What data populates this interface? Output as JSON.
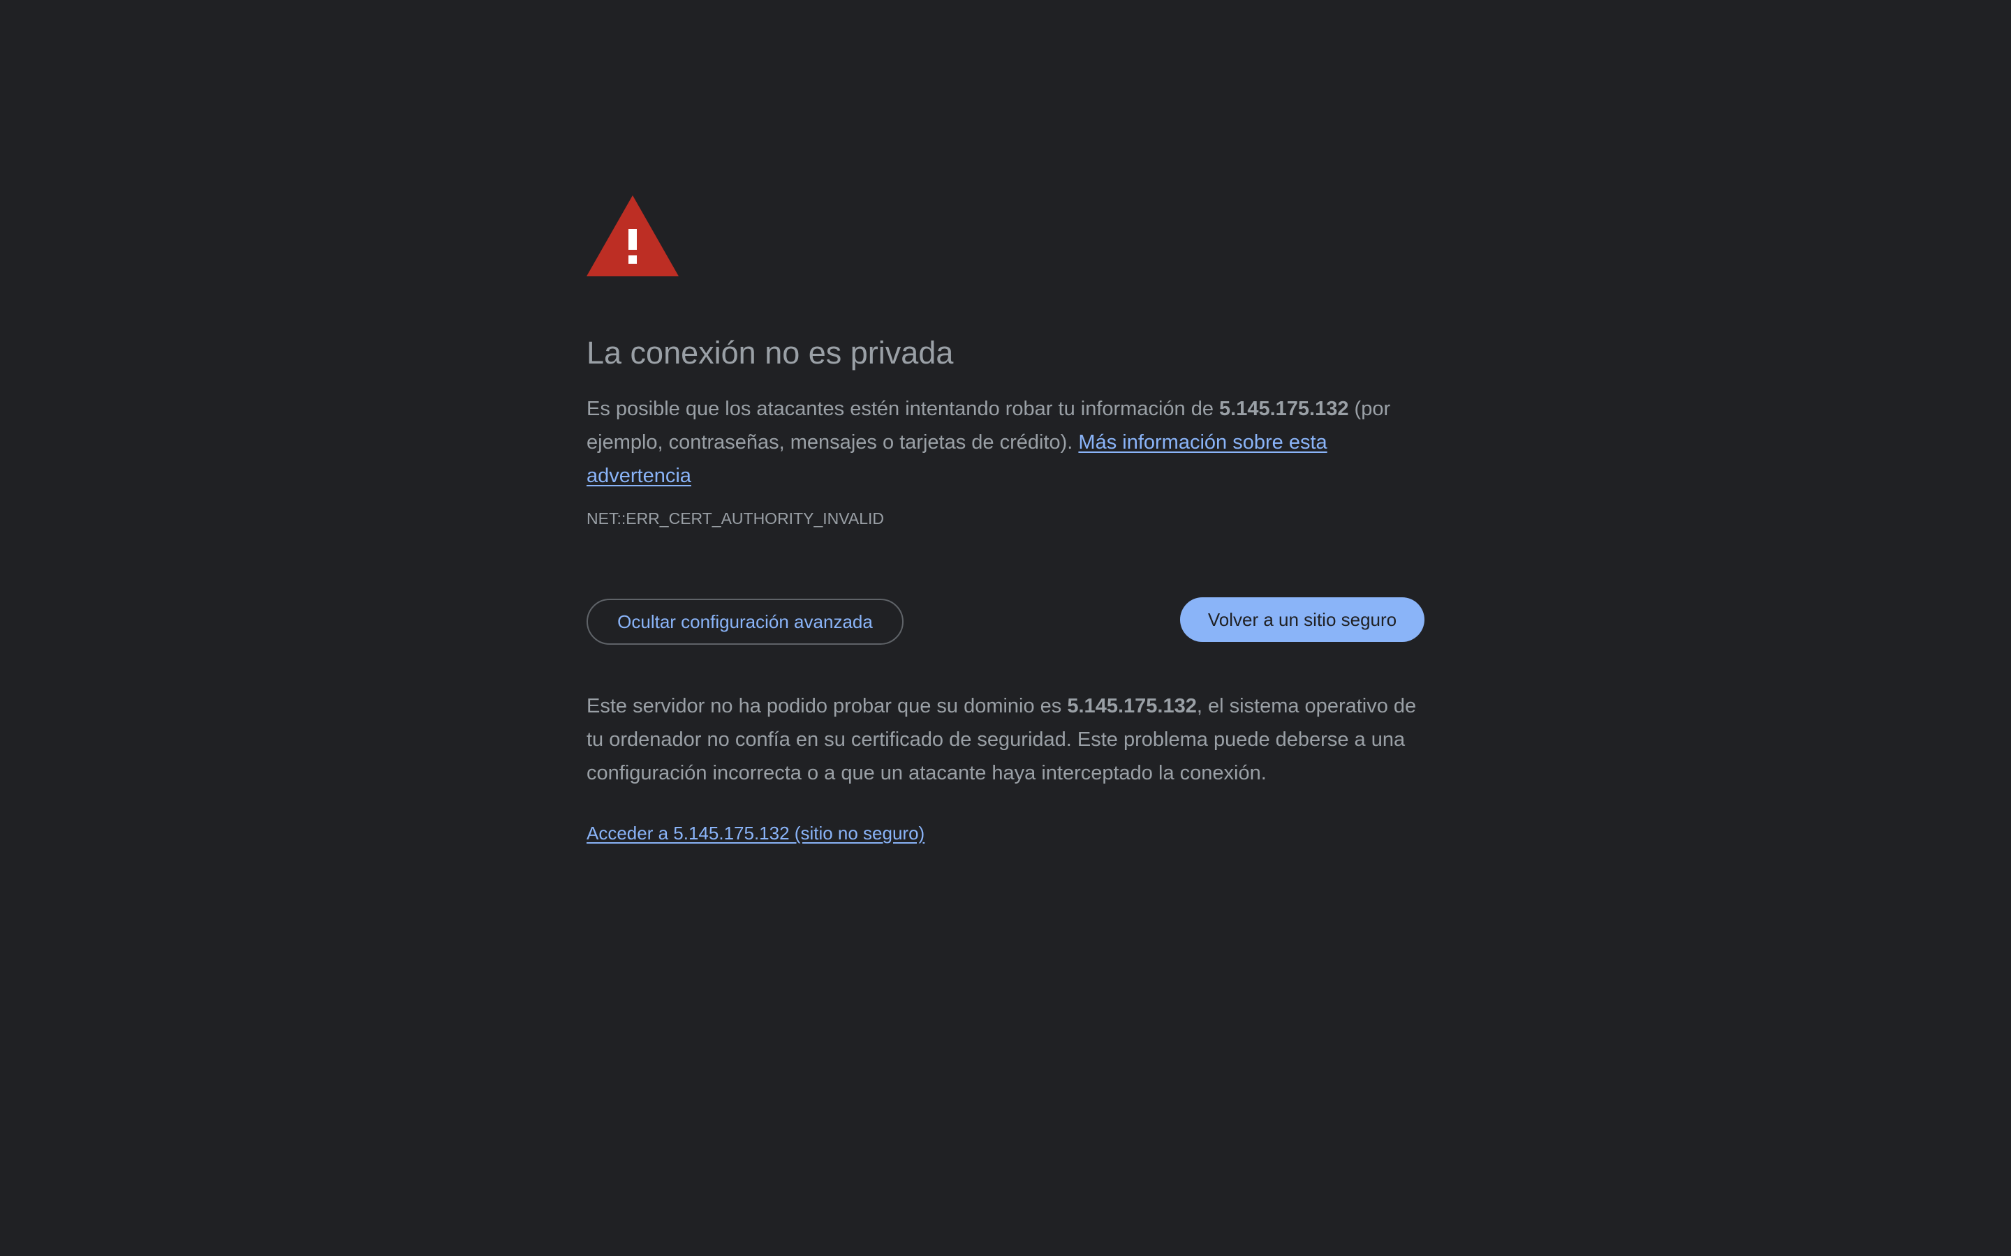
{
  "colors": {
    "background": "#202124",
    "text": "#9aa0a6",
    "link": "#8ab4f8",
    "warning": "#d93025",
    "primary_button_bg": "#8ab4f8",
    "primary_button_text": "#202124",
    "outline_button_border": "#5f6368"
  },
  "icon": {
    "name": "warning-triangle-icon"
  },
  "heading": "La conexión no es privada",
  "intro": {
    "text_before": "Es posible que los atacantes estén intentando robar tu información de ",
    "host": "5.145.175.132",
    "text_after": " (por ejemplo, contraseñas, mensajes o tarjetas de crédito). ",
    "learn_more_link": "Más información sobre esta advertencia"
  },
  "error_code": "NET::ERR_CERT_AUTHORITY_INVALID",
  "buttons": {
    "advanced_label": "Ocultar configuración avanzada",
    "back_label": "Volver a un sitio seguro"
  },
  "details": {
    "text_before": "Este servidor no ha podido probar que su dominio es ",
    "host": "5.145.175.132",
    "text_after": ", el sistema operativo de tu ordenador no confía en su certificado de seguridad. Este problema puede deberse a una configuración incorrecta o a que un atacante haya interceptado la conexión."
  },
  "proceed_link": "Acceder a 5.145.175.132 (sitio no seguro)"
}
